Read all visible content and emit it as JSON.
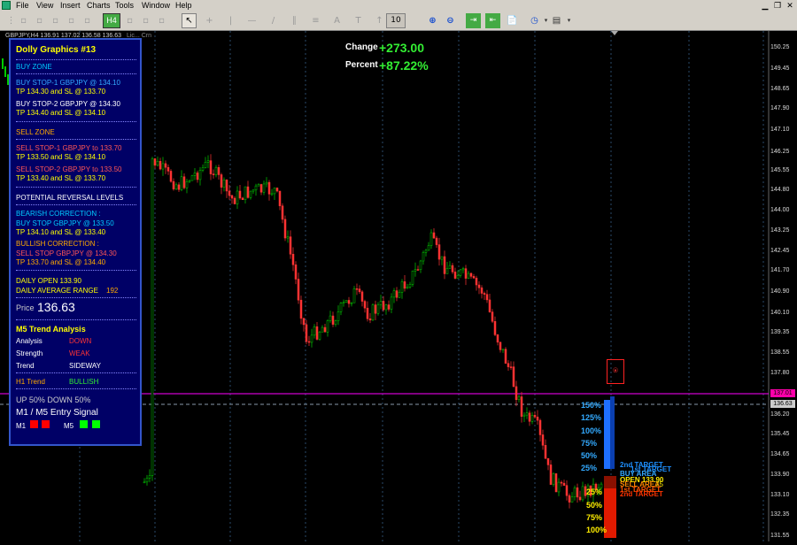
{
  "menubar": {
    "items": [
      "File",
      "View",
      "Insert",
      "Charts",
      "Tools",
      "Window",
      "Help"
    ]
  },
  "toolbar": {
    "period": "H4",
    "zoom_value": "10"
  },
  "chart": {
    "info_line": "GBPJPY,H4 136.91 137.02 136.58 136.63",
    "info_line_suffix": "Lic... Crn",
    "change_label": "Change",
    "change_value": "+273.00",
    "percent_label": "Percent",
    "percent_value": "+87.22%",
    "price_axis": [
      "150.25",
      "149.45",
      "148.65",
      "147.90",
      "147.10",
      "146.25",
      "145.55",
      "144.80",
      "144.00",
      "143.25",
      "142.45",
      "141.70",
      "140.90",
      "140.10",
      "139.35",
      "138.55",
      "137.80",
      "137.01",
      "136.63",
      "136.20",
      "135.45",
      "134.65",
      "133.90",
      "133.10",
      "132.35",
      "131.55"
    ],
    "current_price_tag": "136.63",
    "line_price_tag": "137.01",
    "colors": {
      "bull": "#00cc00",
      "bear": "#ff3333",
      "magenta": "#ff00ff",
      "grid": "#1e3a5a"
    }
  },
  "panel": {
    "title": "Dolly Graphics #13",
    "buy_zone": "BUY ZONE",
    "buy1": "BUY STOP-1  GBPJPY  @     134.10",
    "buy1_tp": "TP 134.30    and SL @   133.70",
    "buy2": "BUY STOP-2  GBPJPY  @     134.30",
    "buy2_tp": "TP 134.40    and SL @   134.10",
    "sell_zone": "SELL ZONE",
    "sell1": "SELL STOP-1  GBPJPY to     133.70",
    "sell1_tp": "TP 133.50    and SL @   134.10",
    "sell2": "SELL STOP-2  GBPJPY to     133.50",
    "sell2_tp": "TP 133.40    and SL @   133.70",
    "prl": "POTENTIAL REVERSAL LEVELS",
    "bear_corr": "BEARISH CORRECTION :",
    "bear_line": "BUY STOP GBPJPY  @     133.50",
    "bear_tp": "TP 134.10    and SL @   133.40",
    "bull_corr": "BULLISH CORRECTION :",
    "bull_line": "SELL STOP GBPJPY  @     134.30",
    "bull_tp": "TP 133.70    and SL @   134.40",
    "daily_open": "DAILY OPEN    133.90",
    "dar_label": "DAILY AVERAGE RANGE",
    "dar_value": "192",
    "price_label": "Price",
    "price_value": "136.63",
    "m5_title": "M5 Trend Analysis",
    "analysis_label": "Analysis",
    "analysis_value": "DOWN",
    "strength_label": "Strength",
    "strength_value": "WEAK",
    "trend_label": "Trend",
    "trend_value": "SIDEWAY",
    "h1_label": "H1 Trend",
    "h1_value": "BULLISH",
    "updown": "UP 50%    DOWN 50%",
    "entry_title": "M1 /  M5 Entry Signal",
    "m1_label": "M1",
    "m5_label": "M5"
  },
  "levels": {
    "up_pcts": [
      "150%",
      "125%",
      "100%",
      "75%",
      "50%",
      "25%"
    ],
    "down_pcts": [
      "25%",
      "50%",
      "75%",
      "100%"
    ],
    "target_labels": [
      "2nd TARGET",
      "1st TARGET",
      "BUY AREA",
      "OPEN 133.90",
      "SELL AREA",
      "1st TARGET",
      "2nd TARGET"
    ],
    "trend_value_1": "75"
  }
}
